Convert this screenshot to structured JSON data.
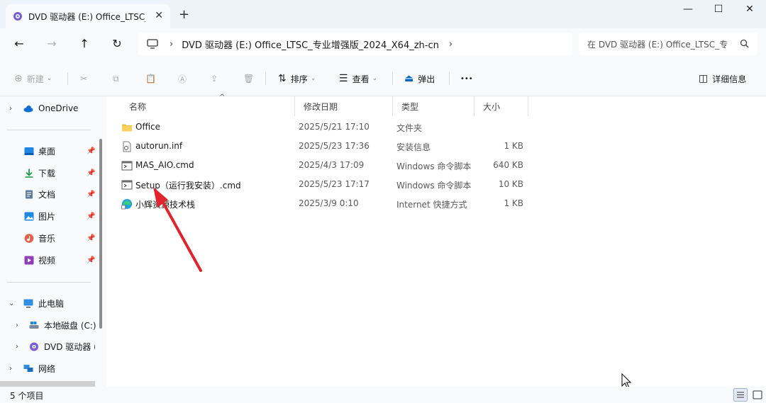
{
  "window": {
    "tab_title": "DVD 驱动器 (E:) Office_LTSC_专",
    "tab_close": "✕",
    "new_tab": "+",
    "min": "—",
    "max": "☐",
    "close": "✕"
  },
  "nav": {
    "back": "←",
    "forward": "→",
    "up": "↑",
    "refresh": "↻",
    "breadcrumb_sep": "›",
    "path": "DVD 驱动器 (E:) Office_LTSC_专业增强版_2024_X64_zh-cn",
    "path_more": "›",
    "search_placeholder": "在 DVD 驱动器 (E:) Office_LTSC_专"
  },
  "toolbar": {
    "new_label": "新建",
    "sort_label": "排序",
    "view_label": "查看",
    "eject_label": "弹出",
    "more_label": "•••",
    "details_label": "详细信息"
  },
  "sidebar": {
    "onedrive": "OneDrive",
    "quick": [
      {
        "label": "桌面"
      },
      {
        "label": "下载"
      },
      {
        "label": "文档"
      },
      {
        "label": "图片"
      },
      {
        "label": "音乐"
      },
      {
        "label": "视频"
      }
    ],
    "this_pc": "此电脑",
    "local_disk": "本地磁盘 (C:)",
    "dvd": "DVD 驱动器 (E",
    "network": "网络"
  },
  "columns": {
    "name": "名称",
    "date": "修改日期",
    "type": "类型",
    "size": "大小"
  },
  "files": [
    {
      "name": "Office",
      "date": "2025/5/21 17:10",
      "type": "文件夹",
      "size": "",
      "icon": "folder-icon"
    },
    {
      "name": "autorun.inf",
      "date": "2025/5/23 17:36",
      "type": "安装信息",
      "size": "1 KB",
      "icon": "inf-file-icon"
    },
    {
      "name": "MAS_AIO.cmd",
      "date": "2025/4/3 17:09",
      "type": "Windows 命令脚本",
      "size": "640 KB",
      "icon": "cmd-file-icon"
    },
    {
      "name": "Setup（运行我安装）.cmd",
      "date": "2025/5/23 17:17",
      "type": "Windows 命令脚本",
      "size": "10 KB",
      "icon": "cmd-file-icon"
    },
    {
      "name": "小辉资源技术栈",
      "date": "2025/3/9 0:10",
      "type": "Internet 快捷方式",
      "size": "1 KB",
      "icon": "edge-shortcut-icon"
    }
  ],
  "status": {
    "count": "5 个项目"
  },
  "colors": {
    "accent": "#0067c0",
    "annotation_arrow": "#e0242e",
    "folder": "#f6c142"
  }
}
